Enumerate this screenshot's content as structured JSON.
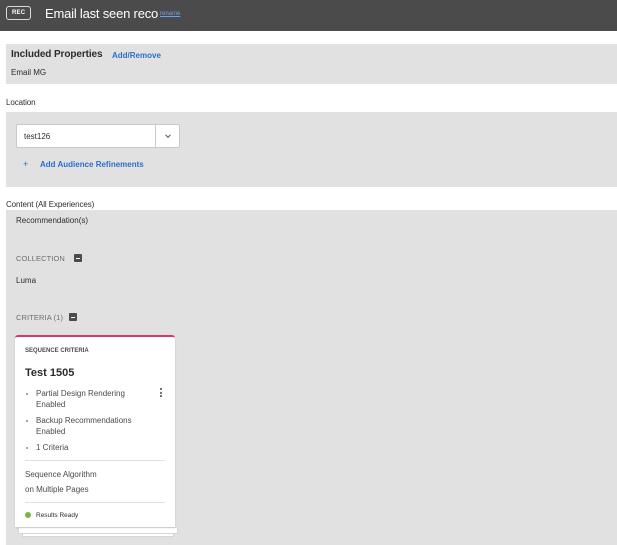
{
  "header": {
    "badge": "REC",
    "title": "Email last seen reco",
    "rename_link": "rename"
  },
  "included_properties": {
    "title": "Included Properties",
    "action": "Add/Remove",
    "value": "Email MG"
  },
  "location": {
    "label": "Location",
    "selected": "test126",
    "refine_icon": "plus-icon",
    "refine_label": "Add Audience Refinements"
  },
  "content": {
    "label": "Content (All Experiences)",
    "recommendations_label": "Recommendation(s)",
    "collection": {
      "heading": "COLLECTION",
      "value": "Luma"
    },
    "criteria": {
      "heading": "CRITERIA (1)",
      "card": {
        "eyebrow": "SEQUENCE CRITERIA",
        "title": "Test 1505",
        "menu_icon": "more-vertical-icon",
        "features": [
          "Partial Design Rendering Enabled",
          "Backup Recommendations Enabled",
          "1 Criteria"
        ],
        "algorithm_line1": "Sequence Algorithm",
        "algorithm_line2": "on Multiple Pages",
        "status": "Results Ready",
        "status_color": "#7ab648",
        "accent_color": "#d13b68"
      }
    }
  }
}
